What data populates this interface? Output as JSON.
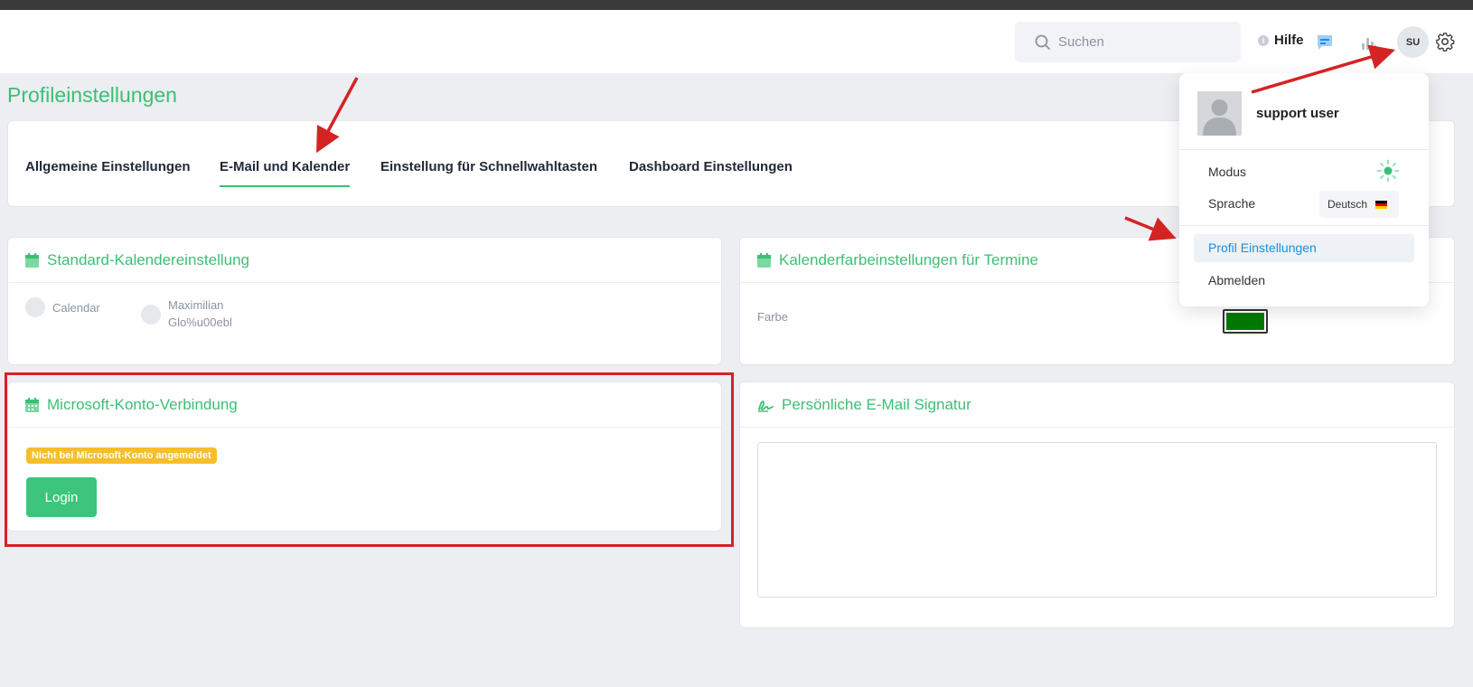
{
  "header": {
    "search_placeholder": "Suchen",
    "help_label": "Hilfe",
    "help_badge": "i",
    "avatar_initials": "SU"
  },
  "page": {
    "title": "Profileinstellungen"
  },
  "tabs": [
    {
      "label": "Allgemeine Einstellungen",
      "active": false
    },
    {
      "label": "E-Mail und Kalender",
      "active": true
    },
    {
      "label": "Einstellung für Schnellwahltasten",
      "active": false
    },
    {
      "label": "Dashboard Einstellungen",
      "active": false
    }
  ],
  "calendar_card": {
    "title": "Standard-Kalendereinstellung",
    "options": [
      {
        "label": "Calendar"
      },
      {
        "label_line1": "Maximilian",
        "label_line2": "Glo%u00ebl"
      }
    ]
  },
  "color_card": {
    "title": "Kalenderfarbeinstellungen für Termine",
    "field_label": "Farbe",
    "color": "#007a00"
  },
  "microsoft_card": {
    "title": "Microsoft-Konto-Verbindung",
    "status_badge": "Nicht bei Microsoft-Konto angemeldet",
    "login_label": "Login"
  },
  "signature_card": {
    "title": "Persönliche E-Mail Signatur",
    "value": ""
  },
  "user_menu": {
    "user_name": "support user",
    "mode_label": "Modus",
    "language_label": "Sprache",
    "language_value": "Deutsch",
    "profile_settings_label": "Profil Einstellungen",
    "logout_label": "Abmelden"
  },
  "colors": {
    "accent": "#3cbf74",
    "badge": "#f7bd2a",
    "link": "#1a8fe0",
    "annotation": "#d42323"
  }
}
